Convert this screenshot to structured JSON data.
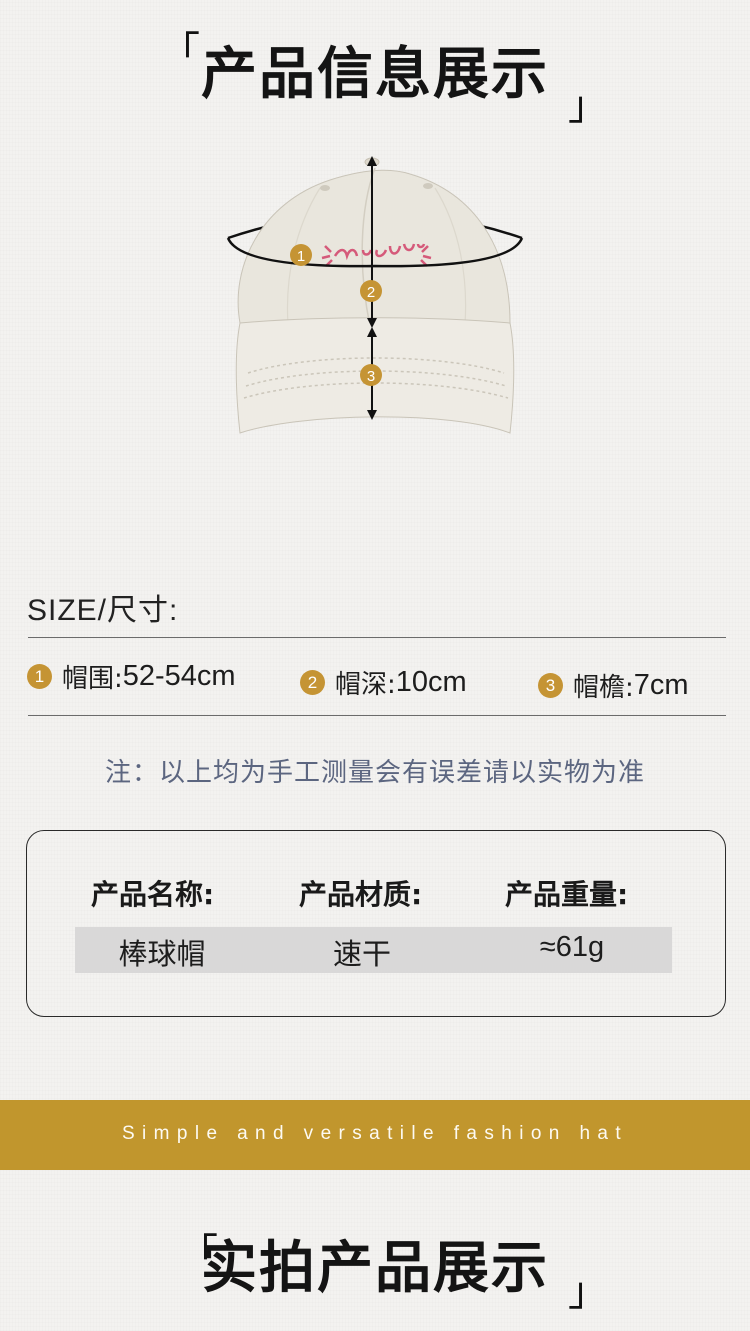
{
  "section_info": {
    "bracket_open": "「",
    "title": "产品信息展示",
    "bracket_close": "」"
  },
  "hat_markers": [
    "1",
    "2",
    "3"
  ],
  "size": {
    "heading": "SIZE/尺寸:",
    "items": [
      {
        "num": "1",
        "label": "帽围:",
        "value": "52-54cm"
      },
      {
        "num": "2",
        "label": "帽深:",
        "value": "10cm"
      },
      {
        "num": "3",
        "label": "帽檐:",
        "value": "7cm"
      }
    ]
  },
  "note": "注：以上均为手工测量会有误差请以实物为准",
  "info_card": {
    "headers": [
      "产品名称:",
      "产品材质:",
      "产品重量:"
    ],
    "values": [
      "棒球帽",
      "速干",
      "≈61g"
    ]
  },
  "banner": {
    "tagline": "Simple and versatile fashion hat"
  },
  "section_real": {
    "bracket_open": "「",
    "title": "实拍产品展示",
    "bracket_close": "」"
  },
  "colors": {
    "accent_gold": "#c59434",
    "band_gold": "#c1962d",
    "background": "#f3f2f0",
    "hat_body": "#e9e6dd",
    "logo_pink": "#d55a7a"
  }
}
